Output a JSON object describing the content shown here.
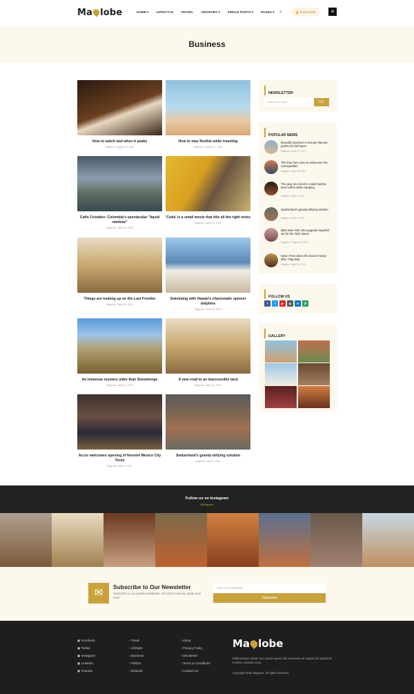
{
  "brand": {
    "pre": "Ma",
    "post": "lobe",
    "accent": "#c9a23c"
  },
  "nav": [
    "HOME ▾",
    "LIFESTYLE",
    "TRAVEL",
    "ARCHIVES ▾",
    "SINGLE POSTS ▾",
    "PAGES ▾"
  ],
  "subscribe_label": "SUBSCRIBE",
  "page_title": "Business",
  "posts": [
    {
      "title": "How to watch and when it peaks",
      "meta": "Watcher / August 23, 2021"
    },
    {
      "title": "How to stay flexible while traveling",
      "meta": "Watcher / August 17, 2021"
    },
    {
      "title": "Caño Cristales: Colombia's spectacular \"liquid rainbow\"",
      "meta": "Magzine / April 16, 2021"
    },
    {
      "title": "'Coda' is a small movie that hits all the right notes",
      "meta": "Magzine / April 16, 2021"
    },
    {
      "title": "Things are looking up on the Last Frontier",
      "meta": "Magzine / April 16, 2021"
    },
    {
      "title": "Swimming with Hawaii's charismatic spinner dolphins",
      "meta": "Magzine / April 16, 2021"
    },
    {
      "title": "An immense mystery older than Stonehenge",
      "meta": "Magzine / April 16, 2021"
    },
    {
      "title": "A new road to an inaccessible land",
      "meta": "Magzine / April 16, 2021"
    },
    {
      "title": "Accor welcomes opening of Novotel Mexico City Toreo",
      "meta": "Magzine / April 9, 2021"
    },
    {
      "title": "Switzerland's gravity-defying solution",
      "meta": "Magzine / April 9, 2021"
    }
  ],
  "newsletter": {
    "title": "NEWSLETTER",
    "placeholder": "Enter your email...",
    "go": "GO"
  },
  "popular": {
    "title": "POPULAR NEWS",
    "items": [
      {
        "title": "Beautiful beaches in Europe that are perfect for fall travel",
        "meta": "Magzine / April 16, 2021"
      },
      {
        "title": "The time has come to rediscover the cosmopolitan",
        "meta": "Magzine / April 16, 2021"
      },
      {
        "title": "The gear you need to make barista-level coffee while camping",
        "meta": "Magzine / April 9, 2021"
      },
      {
        "title": "Switzerland's gravity-defying solution",
        "meta": "Magzine / April 9, 2021"
      },
      {
        "title": "Miss New York USA pageant regretful via for the 2021 issue!",
        "meta": "Magzine / August 23, 2021"
      },
      {
        "title": "Dylan Penn takes the lead in heavy-after 'Flag Day'",
        "meta": "Magzine / April 16, 2021"
      }
    ]
  },
  "follow": {
    "title": "FOLLOW US"
  },
  "gallery": {
    "title": "GALLERY"
  },
  "instagram": {
    "title": "Follow us on Instagram",
    "handle": "@Magzine"
  },
  "nl_band": {
    "title": "Subscribe to Our Newsletter",
    "desc": "Subscribe to our weekly newsletter. We don't read any spam mail ever!",
    "placeholder": "Your email address...",
    "button": "Subscribe"
  },
  "footer": {
    "col1": [
      "Facebook",
      "Twitter",
      "Instagram",
      "LinkedIn",
      "Youtube"
    ],
    "col2": [
      "Travel",
      "Lifestyle",
      "Business",
      "Politics",
      "Network"
    ],
    "col3": [
      "About",
      "Privacy Policy",
      "Disclaimer",
      "Terms & Conditions",
      "Contact Us"
    ],
    "desc": "Pellentesque ornare sem lacinia quam alis venenatis vel magnis dis parturient montes, nascetur mus.",
    "copyright": "Copyright 2022 Magzine. All rights reserved."
  }
}
